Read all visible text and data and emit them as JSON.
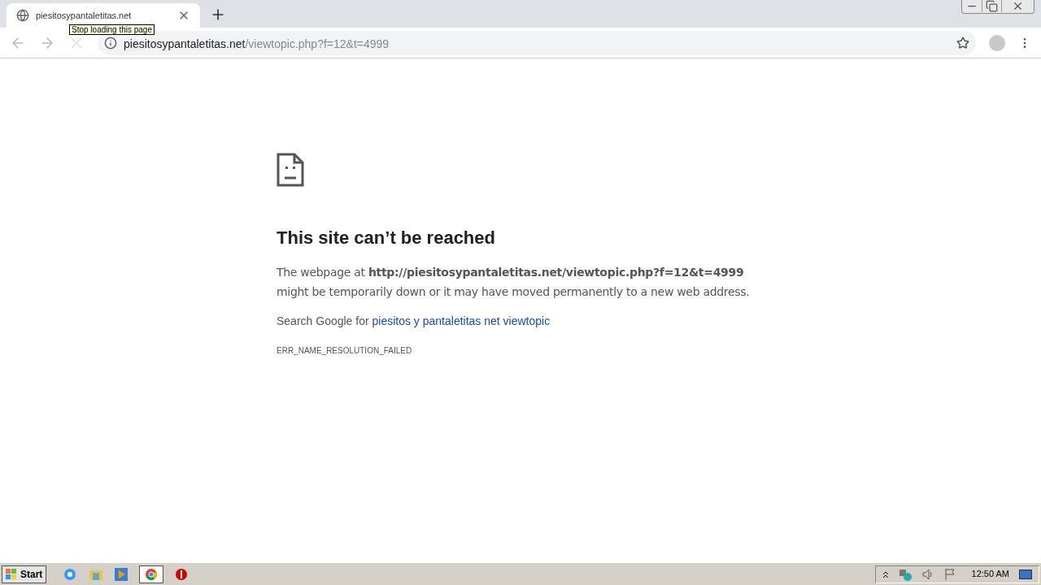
{
  "tab": {
    "title": "piesitosypantaletitas.net",
    "selected": true
  },
  "address_bar": {
    "host": "piesitosypantaletitas.net",
    "path": "/viewtopic.php?f=12&t=4999"
  },
  "tooltip": "Stop loading this page",
  "error_page": {
    "title": "This site can’t be reached",
    "message": "The webpage at **http://piesitosypantaletitas.net/viewtopic.php?f=12&t=4999** might be temporarily down or it may have moved permanently to a new web address.",
    "search_prefix": "Search Google for ",
    "search_link": "piesitos y pantaletitas net viewtopic",
    "error_code": "ERR_NAME_RESOLUTION_FAILED"
  },
  "taskbar": {
    "start": "Start",
    "clock": "12:50 AM"
  }
}
